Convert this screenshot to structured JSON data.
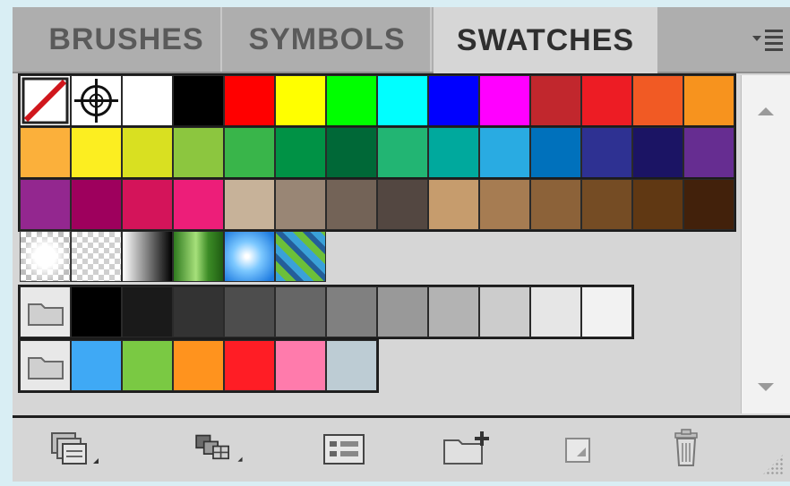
{
  "tabs": [
    {
      "label": "BRUSHES",
      "active": false
    },
    {
      "label": "SYMBOLS",
      "active": false
    },
    {
      "label": "SWATCHES",
      "active": true
    }
  ],
  "panel_menu_icon": "panel-menu-icon",
  "swatch_rows": [
    [
      "none",
      "registration",
      "#ffffff",
      "#000000",
      "#ff0000",
      "#ffff00",
      "#00ff00",
      "#00ffff",
      "#0000ff",
      "#ff00ff",
      "#c1272d",
      "#ed1c24",
      "#f15a24",
      "#f7931e"
    ],
    [
      "#fbb03b",
      "#fcee21",
      "#d9e021",
      "#8cc63f",
      "#39b54a",
      "#009245",
      "#006837",
      "#22b573",
      "#00a99d",
      "#29abe2",
      "#0071bc",
      "#2e3192",
      "#1b1464",
      "#662d91"
    ],
    [
      "#93278f",
      "#9e005d",
      "#d4145a",
      "#ed1e79",
      "#c7b299",
      "#998675",
      "#736357",
      "#534741",
      "#c69c6d",
      "#a67c52",
      "#8c6239",
      "#754c24",
      "#603813",
      "#42210b"
    ]
  ],
  "gradient_pattern_row": [
    "radial-transparent",
    "checker-transparent",
    "linear-black-white",
    "green-cylinder",
    "blue-radial",
    "green-blue-pattern"
  ],
  "grays_group": [
    "#000000",
    "#1a1a1a",
    "#333333",
    "#4d4d4d",
    "#666666",
    "#808080",
    "#999999",
    "#b3b3b3",
    "#cccccc",
    "#e6e6e6",
    "#f2f2f2"
  ],
  "brights_group": [
    "#3fa9f5",
    "#7ac943",
    "#ff931e",
    "#ff1d25",
    "#ff7bac",
    "#bdccd4"
  ],
  "bottom_buttons": [
    "swatch-libraries-menu-icon",
    "show-swatch-kinds-menu-icon",
    "swatch-options-icon",
    "new-color-group-icon",
    "new-swatch-icon",
    "delete-swatch-icon"
  ]
}
